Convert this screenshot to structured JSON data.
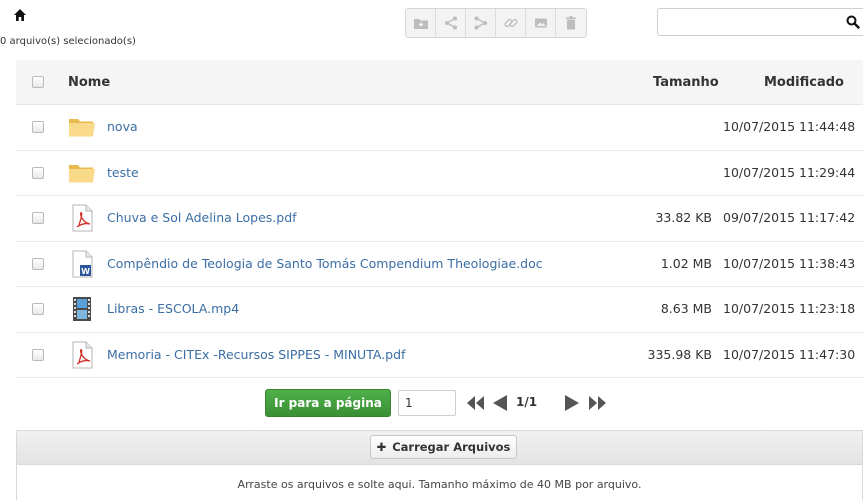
{
  "header": {
    "home_icon": "home-icon",
    "selected_count": "0 arquivo(s) selecionado(s)"
  },
  "toolbar": {
    "buttons": [
      {
        "name": "new-folder-icon"
      },
      {
        "name": "share-icon"
      },
      {
        "name": "move-icon"
      },
      {
        "name": "link-icon"
      },
      {
        "name": "image-icon"
      },
      {
        "name": "trash-icon"
      }
    ]
  },
  "search": {
    "value": "",
    "icon": "search-icon"
  },
  "table": {
    "headers": {
      "name": "Nome",
      "size": "Tamanho",
      "modified": "Modificado"
    },
    "rows": [
      {
        "type": "folder",
        "name": "nova",
        "size": "",
        "modified": "10/07/2015 11:44:48"
      },
      {
        "type": "folder",
        "name": "teste",
        "size": "",
        "modified": "10/07/2015 11:29:44"
      },
      {
        "type": "pdf",
        "name": "Chuva e Sol Adelina Lopes.pdf",
        "size": "33.82 KB",
        "modified": "09/07/2015 11:17:42"
      },
      {
        "type": "doc",
        "name": "Compêndio de Teologia de Santo Tomás Compendium Theologiae.doc",
        "size": "1.02 MB",
        "modified": "10/07/2015 11:38:43"
      },
      {
        "type": "video",
        "name": "Libras - ESCOLA.mp4",
        "size": "8.63 MB",
        "modified": "10/07/2015 11:23:18"
      },
      {
        "type": "pdf",
        "name": "Memoria - CITEx -Recursos SIPPES - MINUTA.pdf",
        "size": "335.98 KB",
        "modified": "10/07/2015 11:47:30"
      }
    ]
  },
  "pager": {
    "goto_label": "Ir para a página",
    "page_value": "1",
    "page_label": "1/1"
  },
  "upload": {
    "button_label": "Carregar Arquivos",
    "hint": "Arraste os arquivos e solte aqui. Tamanho máximo de 40 MB por arquivo."
  },
  "colors": {
    "link": "#3a6ea5",
    "green_button": "#3f9a39",
    "folder": "#f7d27a"
  }
}
